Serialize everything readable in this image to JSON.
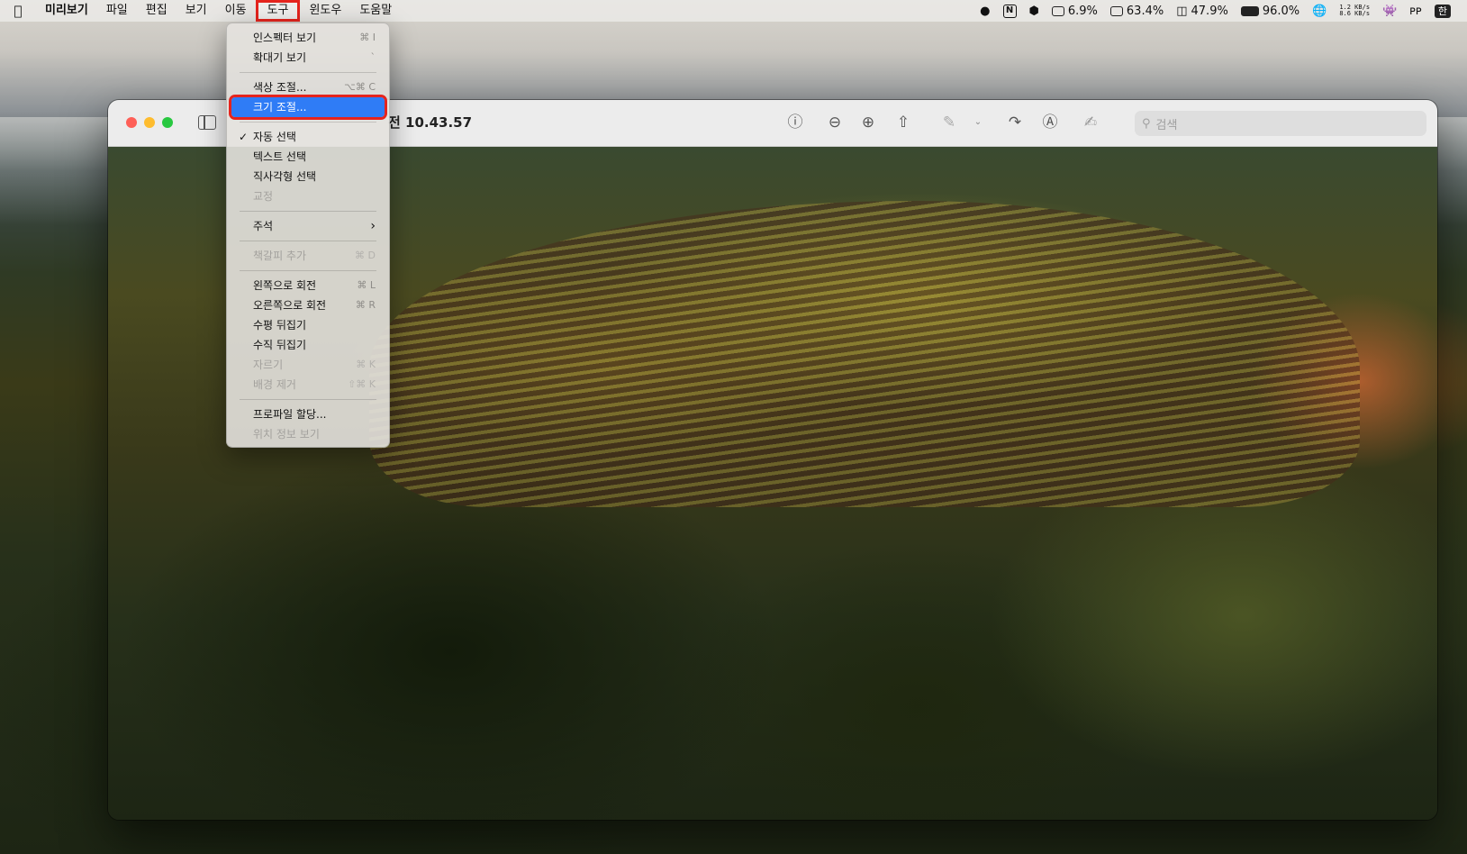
{
  "menubar": {
    "apple": "",
    "app": "미리보기",
    "items": [
      "파일",
      "편집",
      "보기",
      "이동",
      "도구",
      "윈도우",
      "도움말"
    ],
    "open_index": 4,
    "status": {
      "cpu": "6.9%",
      "gpu": "63.4%",
      "disk": "47.9%",
      "battery": "96.0%",
      "net_up": "1.2 KB/s",
      "net_down": "8.6 KB/s",
      "notion": "N",
      "input_source": "한"
    }
  },
  "window": {
    "title": "전 10.43.57",
    "search_placeholder": "검색"
  },
  "tools_menu": {
    "groups": [
      [
        {
          "label": "인스펙터 보기",
          "shortcut": "⌘ I",
          "enabled": true
        },
        {
          "label": "확대기 보기",
          "shortcut": "`",
          "enabled": true
        }
      ],
      [
        {
          "label": "색상 조절...",
          "shortcut": "⌥⌘ C",
          "enabled": true
        },
        {
          "label": "크기 조절...",
          "shortcut": "",
          "enabled": true,
          "highlighted": true
        }
      ],
      [
        {
          "label": "자동 선택",
          "shortcut": "",
          "enabled": true,
          "checked": true
        },
        {
          "label": "텍스트 선택",
          "shortcut": "",
          "enabled": true
        },
        {
          "label": "직사각형 선택",
          "shortcut": "",
          "enabled": true
        },
        {
          "label": "교정",
          "shortcut": "",
          "enabled": false
        }
      ],
      [
        {
          "label": "주석",
          "shortcut": "",
          "enabled": true,
          "submenu": true
        }
      ],
      [
        {
          "label": "책갈피 추가",
          "shortcut": "⌘ D",
          "enabled": false
        }
      ],
      [
        {
          "label": "왼쪽으로 회전",
          "shortcut": "⌘ L",
          "enabled": true
        },
        {
          "label": "오른쪽으로 회전",
          "shortcut": "⌘ R",
          "enabled": true
        },
        {
          "label": "수평 뒤집기",
          "shortcut": "",
          "enabled": true
        },
        {
          "label": "수직 뒤집기",
          "shortcut": "",
          "enabled": true
        },
        {
          "label": "자르기",
          "shortcut": "⌘ K",
          "enabled": false
        },
        {
          "label": "배경 제거",
          "shortcut": "⇧⌘ K",
          "enabled": false
        }
      ],
      [
        {
          "label": "프로파일 할당...",
          "shortcut": "",
          "enabled": true
        },
        {
          "label": "위치 정보 보기",
          "shortcut": "",
          "enabled": false
        }
      ]
    ]
  },
  "colors": {
    "highlight": "#2f7cf6",
    "annotation_red": "#e5241d"
  }
}
